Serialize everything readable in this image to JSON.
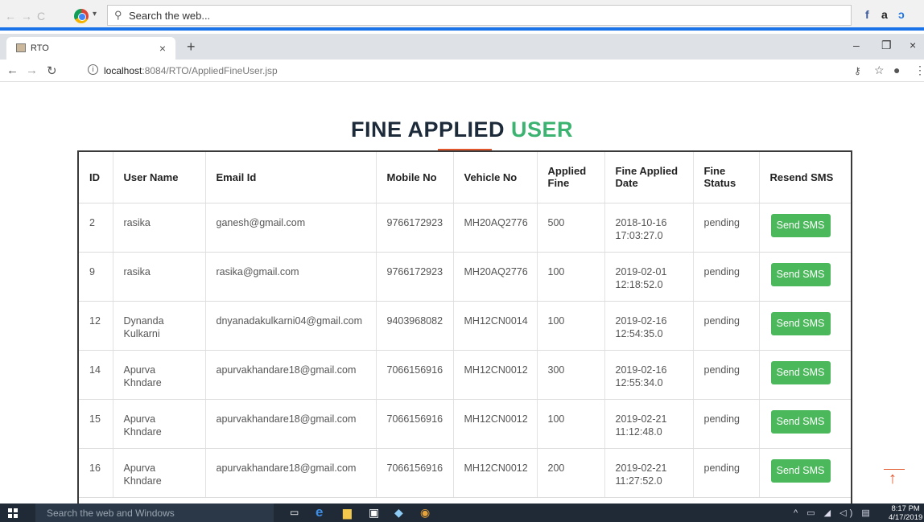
{
  "search_toolbar": {
    "placeholder": "Search the web...",
    "extensions": [
      "facebook-icon",
      "amazon-icon",
      "extension-icon"
    ]
  },
  "tab": {
    "title": "RTO"
  },
  "address_bar": {
    "host": "localhost",
    "path": ":8084/RTO/AppliedFineUser.jsp"
  },
  "page": {
    "heading_main": "FINE APPLIED ",
    "heading_accent": "USER",
    "accent_color": "#3cb371",
    "underline_color": "#e2562b"
  },
  "table": {
    "columns": [
      "ID",
      "User Name",
      "Email Id",
      "Mobile No",
      "Vehicle No",
      "Applied Fine",
      "Fine Applied Date",
      "Fine Status",
      "Resend SMS"
    ],
    "rows": [
      {
        "id": "2",
        "user_name": "rasika",
        "email": "ganesh@gmail.com",
        "mobile": "9766172923",
        "vehicle": "MH20AQ2776",
        "fine": "500",
        "date": "2018-10-16 17:03:27.0",
        "status": "pending",
        "action": "Send SMS"
      },
      {
        "id": "9",
        "user_name": "rasika",
        "email": "rasika@gmail.com",
        "mobile": "9766172923",
        "vehicle": "MH20AQ2776",
        "fine": "100",
        "date": "2019-02-01 12:18:52.0",
        "status": "pending",
        "action": "Send SMS"
      },
      {
        "id": "12",
        "user_name": "Dynanda Kulkarni",
        "email": "dnyanadakulkarni04@gmail.com",
        "mobile": "9403968082",
        "vehicle": "MH12CN0014",
        "fine": "100",
        "date": "2019-02-16 12:54:35.0",
        "status": "pending",
        "action": "Send SMS"
      },
      {
        "id": "14",
        "user_name": "Apurva Khndare",
        "email": "apurvakhandare18@gmail.com",
        "mobile": "7066156916",
        "vehicle": "MH12CN0012",
        "fine": "300",
        "date": "2019-02-16 12:55:34.0",
        "status": "pending",
        "action": "Send SMS"
      },
      {
        "id": "15",
        "user_name": "Apurva Khndare",
        "email": "apurvakhandare18@gmail.com",
        "mobile": "7066156916",
        "vehicle": "MH12CN0012",
        "fine": "100",
        "date": "2019-02-21 11:12:48.0",
        "status": "pending",
        "action": "Send SMS"
      },
      {
        "id": "16",
        "user_name": "Apurva Khndare",
        "email": "apurvakhandare18@gmail.com",
        "mobile": "7066156916",
        "vehicle": "MH12CN0012",
        "fine": "200",
        "date": "2019-02-21 11:27:52.0",
        "status": "pending",
        "action": "Send SMS"
      }
    ]
  },
  "taskbar": {
    "search_placeholder": "Search the web and Windows",
    "time": "8:17 PM",
    "date": "4/17/2019"
  }
}
